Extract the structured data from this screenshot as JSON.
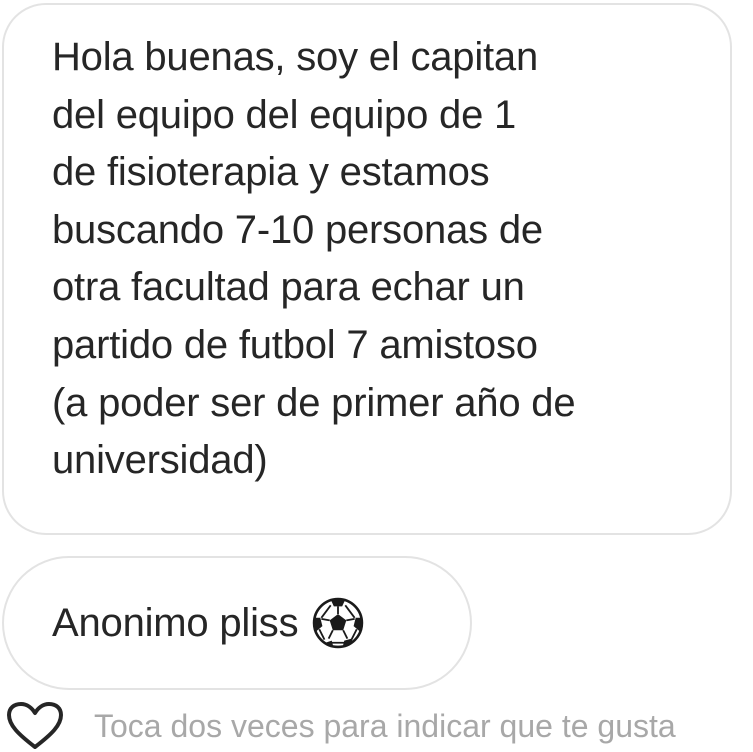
{
  "messages": [
    {
      "lines": [
        "Hola buenas, soy el capitan",
        "del equipo del equipo de 1",
        "de fisioterapia y estamos",
        "buscando 7-10 personas de",
        "otra facultad para echar un",
        "partido de futbol 7 amistoso",
        "(a poder ser de primer año de",
        "universidad)"
      ]
    },
    {
      "text": "Anonimo pliss",
      "emoji": "soccer-ball-icon"
    }
  ],
  "like": {
    "icon": "heart-outline-icon",
    "hint": "Toca dos veces para indicar que te gusta"
  },
  "colors": {
    "bubble_border": "#e3e3e3",
    "text": "#262626",
    "hint_text": "#a8a8a8",
    "heart_stroke": "#262626"
  }
}
